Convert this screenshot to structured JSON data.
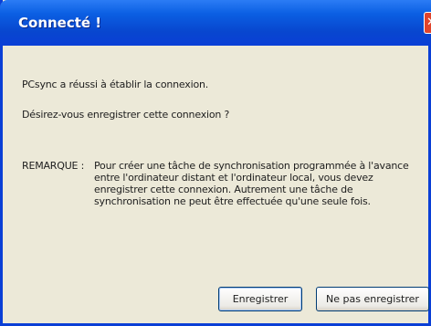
{
  "window": {
    "title": "Connecté !",
    "close_label": "✕"
  },
  "message": {
    "line1": "PCsync a réussi à établir la connexion.",
    "line2": "Désirez-vous enregistrer cette connexion ?",
    "note_label": "REMARQUE :",
    "note_text": "Pour créer une tâche de synchronisation programmée à l'avance entre l'ordinateur distant et l'ordinateur local, vous devez enregistrer cette connexion. Autrement une tâche de synchronisation ne peut être effectuée qu'une seule fois."
  },
  "buttons": {
    "save": "Enregistrer",
    "no_save": "Ne pas enregistrer"
  },
  "colors": {
    "titlebar": "#0a3fd6",
    "close": "#e0442c",
    "face": "#ece9d8"
  }
}
